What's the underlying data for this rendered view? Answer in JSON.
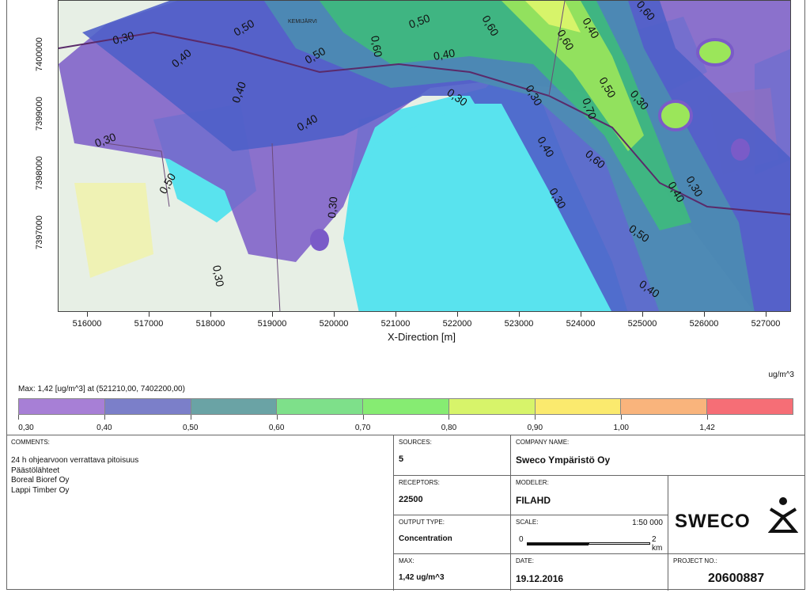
{
  "map": {
    "y_ticks": [
      "7400000",
      "7399000",
      "7398000",
      "7397000"
    ],
    "x_ticks": [
      "516000",
      "517000",
      "518000",
      "519000",
      "520000",
      "521000",
      "522000",
      "523000",
      "524000",
      "525000",
      "526000",
      "527000"
    ],
    "x_label": "X-Direction [m]",
    "town_label": "KEMIJÄRVI",
    "contour_labels": [
      "0,30",
      "0,40",
      "0,50",
      "0,60",
      "0,70"
    ],
    "colors": {
      "lake": "#59e3ee",
      "land": "#e7efe5",
      "c030": "#7a5bc8",
      "c040": "#4f5fc9",
      "c050": "#4b8fb0",
      "c060": "#3dbd79",
      "c070": "#9be65a"
    }
  },
  "legend": {
    "units": "ug/m^3",
    "max_text": "Max:  1,42  [ug/m^3]  at  (521210,00, 7402200,00)",
    "labels": [
      "0,30",
      "0,40",
      "0,50",
      "0,60",
      "0,70",
      "0,80",
      "0,90",
      "1,00",
      "1,42"
    ],
    "colors": [
      "#a77fd6",
      "#7b7fc9",
      "#6aa3a5",
      "#7ee08a",
      "#86ec72",
      "#d7f46a",
      "#fbea6e",
      "#f9b47c",
      "#f66e76"
    ]
  },
  "titleblock": {
    "comments_caption": "COMMENTS:",
    "comments": [
      "24 h ohjearvoon verrattava pitoisuus",
      "Päästölähteet",
      "Boreal Bioref Oy",
      "Lappi Timber Oy"
    ],
    "sources_caption": "SOURCES:",
    "sources": "5",
    "company_caption": "COMPANY NAME:",
    "company": "Sweco Ympäristö Oy",
    "receptors_caption": "RECEPTORS:",
    "receptors": "22500",
    "modeler_caption": "MODELER:",
    "modeler": "FILAHD",
    "output_caption": "OUTPUT TYPE:",
    "output": "Concentration",
    "scale_caption": "SCALE:",
    "scale": "1:50 000",
    "scale_start": "0",
    "scale_end": "2 km",
    "max_caption": "MAX:",
    "max": "1,42 ug/m^3",
    "date_caption": "DATE:",
    "date": "19.12.2016",
    "project_caption": "PROJECT NO.:",
    "project": "20600887",
    "logo_text": "SWECO"
  }
}
